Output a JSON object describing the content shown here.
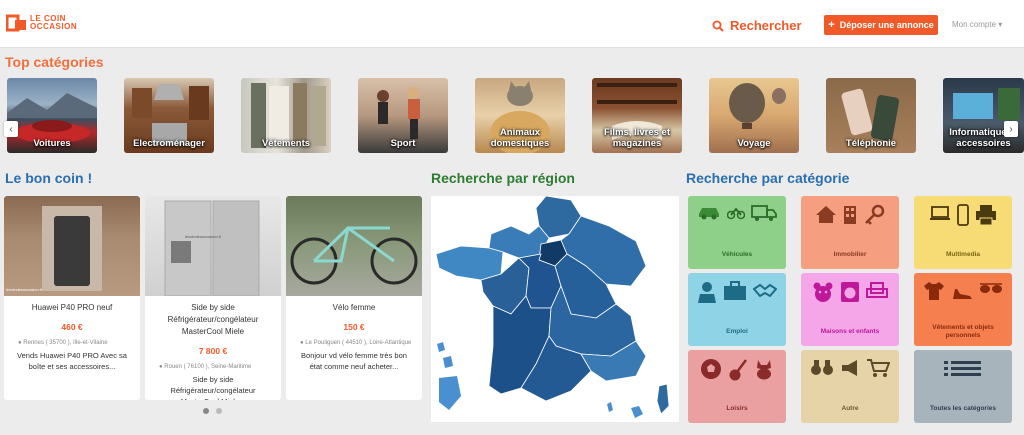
{
  "header": {
    "logo_line1": "LE COIN",
    "logo_line2": "OCCASION",
    "search_label": "Rechercher",
    "post_button_label": "Déposer une annonce",
    "account_label": "Mon compte"
  },
  "top_categories": {
    "title": "Top catégories",
    "items": [
      {
        "label": "Voitures"
      },
      {
        "label": "Electroménager"
      },
      {
        "label": "Vêtements"
      },
      {
        "label": "Sport"
      },
      {
        "label": "Animaux domestiques"
      },
      {
        "label": "Films, livres et magazines"
      },
      {
        "label": "Voyage"
      },
      {
        "label": "Téléphonie"
      },
      {
        "label": "Informatique et accessoires"
      }
    ]
  },
  "bon_coin": {
    "title": "Le bon coin !",
    "listings": [
      {
        "title": "Huawei P40 PRO neuf",
        "price": "460 €",
        "location": "Rennes ( 35700 ), Ille-et-Vilaine",
        "description": "Vends Huawei P40 PRO Avec sa boîte et ses accessoires..."
      },
      {
        "title": "Side by side Réfrigérateur/congélateur MasterCool Miele",
        "price": "7 800 €",
        "location": "Rouen ( 76100 ), Seine-Maritime",
        "description": "Side by side Réfrigérateur/congélateur MasterCool Miele..."
      },
      {
        "title": "Vélo femme",
        "price": "150 €",
        "location": "Le Pouliguen ( 44510 ), Loire-Atlantique",
        "description": "Bonjour vd vélo femme très bon état comme neuf acheter..."
      }
    ],
    "watermark": "lecoindesoccasion.fr"
  },
  "region": {
    "title": "Recherche par région"
  },
  "par_categorie": {
    "title": "Recherche par catégorie",
    "tiles": [
      {
        "label": "Véhicules",
        "color": "#8ed08a",
        "text_color": "#2e6b2a"
      },
      {
        "label": "Immobilier",
        "color": "#f59e80",
        "text_color": "#8a3b22"
      },
      {
        "label": "Multimedia",
        "color": "#f7dc76",
        "text_color": "#7a6210"
      },
      {
        "label": "Emploi",
        "color": "#8fd3e6",
        "text_color": "#1e6b85"
      },
      {
        "label": "Maisons et enfants",
        "color": "#f5a6e8",
        "text_color": "#c0189a"
      },
      {
        "label": "Vêtements et objets personnels",
        "color": "#f57f4f",
        "text_color": "#8a2a0a"
      },
      {
        "label": "Loisirs",
        "color": "#eaa0a0",
        "text_color": "#8a2a2a"
      },
      {
        "label": "Autre",
        "color": "#e6d4a8",
        "text_color": "#6b5a2e"
      },
      {
        "label": "Toutes les catégories",
        "color": "#a8b4bc",
        "text_color": "#2c3e50"
      }
    ]
  }
}
